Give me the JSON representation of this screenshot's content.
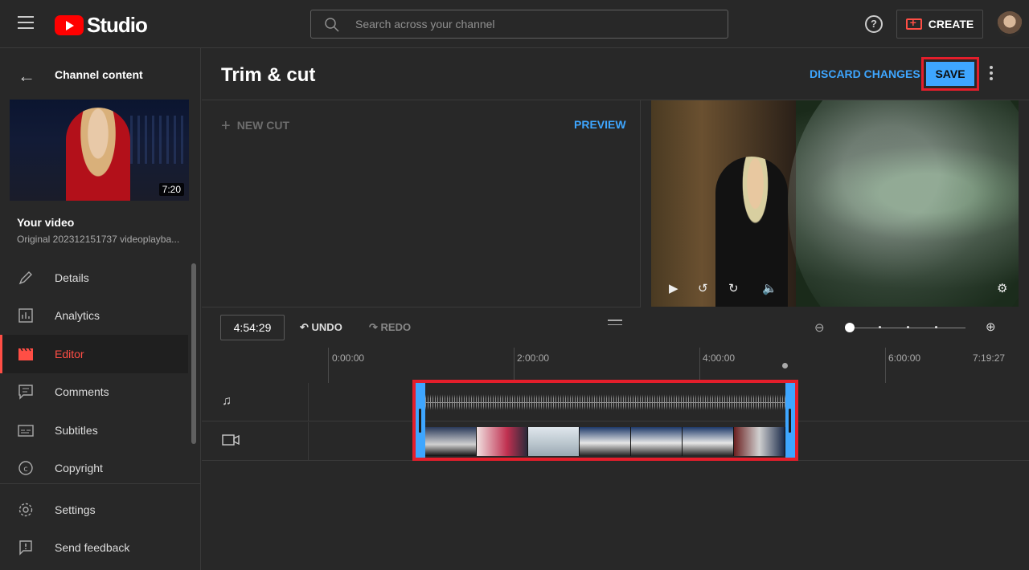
{
  "header": {
    "logo_text": "Studio",
    "search_placeholder": "Search across your channel",
    "help_label": "?",
    "create_label": "CREATE"
  },
  "sidebar": {
    "title": "Channel content",
    "thumbnail_duration": "7:20",
    "video_heading": "Your video",
    "video_name": "Original 202312151737 videoplayba...",
    "items": [
      {
        "label": "Details",
        "icon": "pencil-icon"
      },
      {
        "label": "Analytics",
        "icon": "analytics-icon"
      },
      {
        "label": "Editor",
        "icon": "editor-icon",
        "active": true
      },
      {
        "label": "Comments",
        "icon": "comments-icon"
      },
      {
        "label": "Subtitles",
        "icon": "subtitles-icon"
      },
      {
        "label": "Copyright",
        "icon": "copyright-icon"
      }
    ],
    "bottom_items": [
      {
        "label": "Settings",
        "icon": "gear-icon"
      },
      {
        "label": "Send feedback",
        "icon": "feedback-icon"
      }
    ]
  },
  "editor": {
    "title": "Trim & cut",
    "discard_label": "DISCARD CHANGES",
    "save_label": "SAVE",
    "new_cut_label": "NEW CUT",
    "preview_label": "PREVIEW"
  },
  "timeline": {
    "timecode": "4:54:29",
    "undo_label": "UNDO",
    "redo_label": "REDO",
    "ruler_labels": [
      "0:00:00",
      "2:00:00",
      "4:00:00",
      "6:00:00",
      "7:19:27"
    ]
  },
  "colors": {
    "accent_blue": "#3ea6ff",
    "brand_red": "#ff0000",
    "highlight_red": "#e41e2b",
    "active_nav": "#ff4e45"
  }
}
